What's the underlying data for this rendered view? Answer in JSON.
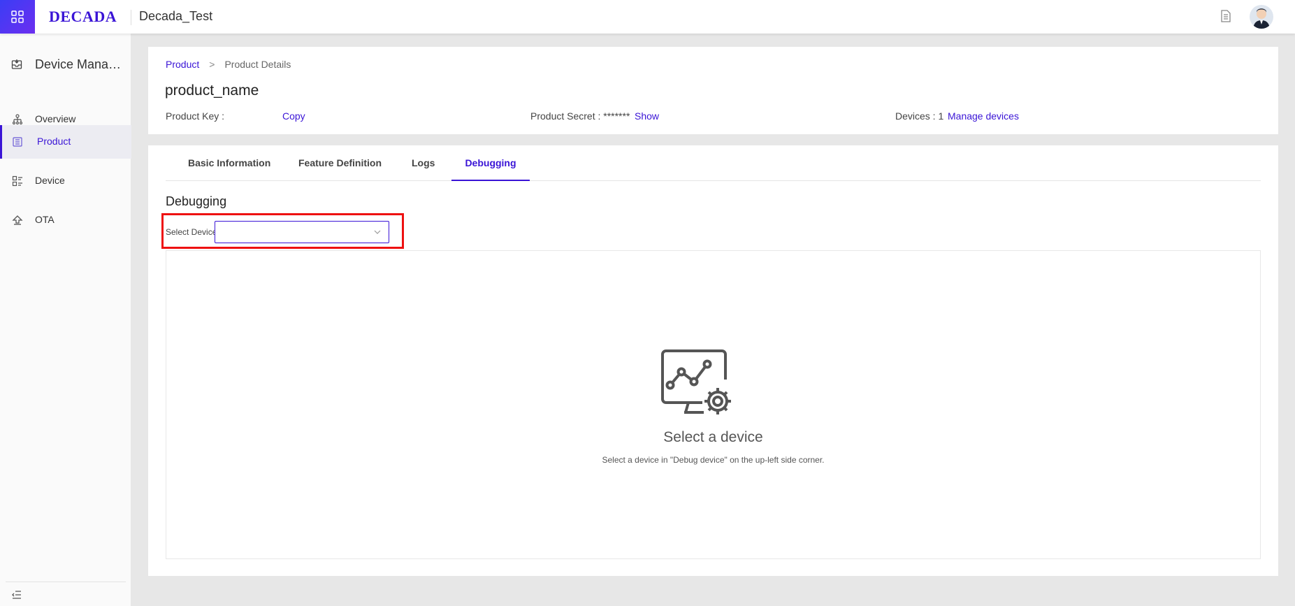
{
  "header": {
    "logo": "DECADA",
    "project": "Decada_Test",
    "icons": [
      "apps-grid-icon",
      "document-icon",
      "user-avatar"
    ]
  },
  "sidebar": {
    "title": "Device Mana…",
    "items": [
      {
        "label": "Overview",
        "icon": "hierarchy-icon"
      },
      {
        "label": "Product",
        "icon": "product-list-icon"
      },
      {
        "label": "Device",
        "icon": "device-list-icon"
      },
      {
        "label": "OTA",
        "icon": "upload-icon"
      }
    ],
    "active_index": 1
  },
  "breadcrumb": {
    "root": "Product",
    "sep": ">",
    "current": "Product Details"
  },
  "product": {
    "name": "product_name",
    "key_label": "Product Key :",
    "copy_label": "Copy",
    "secret_label": "Product Secret : *******",
    "show_label": "Show",
    "devices_label": "Devices : 1",
    "manage_label": "Manage devices"
  },
  "tabs": [
    "Basic Information",
    "Feature Definition",
    "Logs",
    "Debugging"
  ],
  "active_tab": "Debugging",
  "debug": {
    "title": "Debugging",
    "select_label": "Select Device:",
    "select_value": "",
    "empty_title": "Select a device",
    "empty_sub": "Select a device in \"Debug device\" on the up-left side corner."
  },
  "colors": {
    "accent": "#3a14d6",
    "highlight": "#ee1111"
  }
}
